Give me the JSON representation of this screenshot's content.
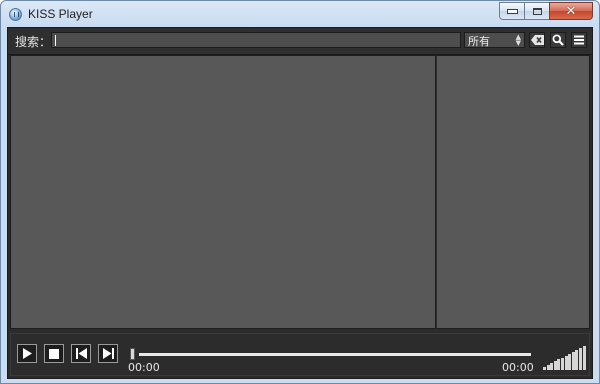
{
  "window": {
    "title": "KISS Player",
    "icons": {
      "app": "app-logo-icon",
      "minimize": "minimize-icon",
      "maximize": "maximize-icon",
      "close": "close-icon"
    }
  },
  "search": {
    "label": "搜索：",
    "value": "",
    "filter_selected": "所有",
    "icons": {
      "clear": "clear-backspace-icon",
      "search": "search-icon",
      "menu": "menu-icon"
    }
  },
  "player": {
    "current_time": "00:00",
    "total_time": "00:00",
    "progress": 0,
    "volume_level": 1.0,
    "icons": {
      "play": "play-icon",
      "stop": "stop-icon",
      "previous": "previous-icon",
      "next": "next-icon",
      "volume": "volume-bars-icon"
    }
  },
  "colors": {
    "panel_bg": "#585858",
    "frame_bg": "#2b2b2b",
    "title_bar": "#c9dcf1",
    "close_button": "#c4462d"
  }
}
